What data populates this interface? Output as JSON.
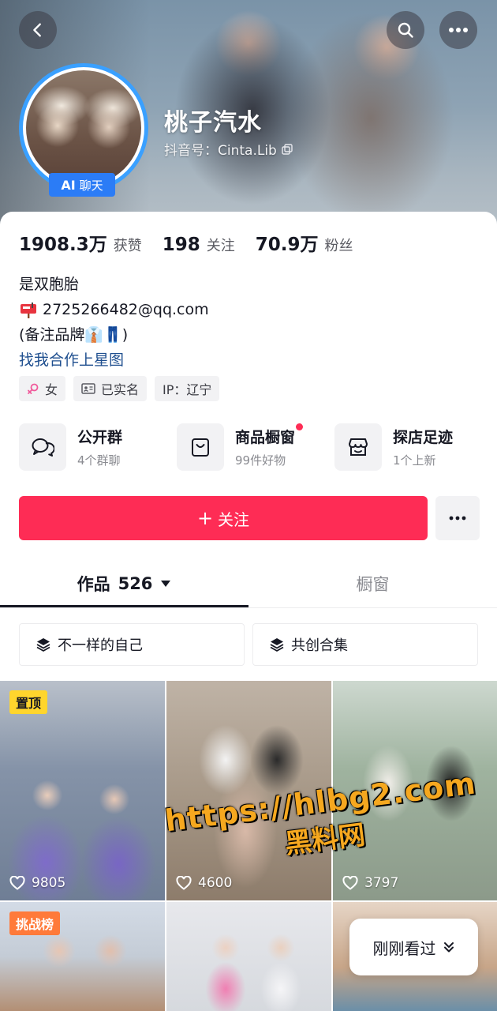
{
  "profile": {
    "nickname": "桃子汽水",
    "douyin_id": "抖音号：Cinta.Lib",
    "ai_badge": {
      "ai": "AI",
      "label": "聊天"
    }
  },
  "stats": [
    {
      "value": "1908.3万",
      "label": "获赞"
    },
    {
      "value": "198",
      "label": "关注"
    },
    {
      "value": "70.9万",
      "label": "粉丝"
    }
  ],
  "bio": {
    "line1": "是双胞胎",
    "email": "2725266482@qq.com",
    "line3": "(备注品牌👔👖)",
    "link": "找我合作上星图"
  },
  "tags": [
    {
      "icon": "female-icon",
      "label": "女"
    },
    {
      "icon": "id-card-icon",
      "label": "已实名"
    },
    {
      "icon": "",
      "label": "IP：辽宁"
    }
  ],
  "services": [
    {
      "icon": "chat-bubbles-icon",
      "title": "公开群",
      "subtitle": "4个群聊",
      "dot": false
    },
    {
      "icon": "shopping-bag-icon",
      "title": "商品橱窗",
      "subtitle": "99件好物",
      "dot": true
    },
    {
      "icon": "shop-icon",
      "title": "探店足迹",
      "subtitle": "1个上新",
      "dot": false
    }
  ],
  "actions": {
    "follow": "关注",
    "follow_plus": "+"
  },
  "tabs": {
    "works": "作品",
    "works_count": "526",
    "window": "橱窗"
  },
  "collections": [
    {
      "label": "不一样的自己"
    },
    {
      "label": "共创合集"
    }
  ],
  "videos": [
    {
      "badge": "置顶",
      "likes": "9805"
    },
    {
      "badge": "",
      "likes": "4600"
    },
    {
      "badge": "",
      "likes": "3797"
    },
    {
      "badge": "挑战榜",
      "likes": ""
    },
    {
      "badge": "",
      "likes": ""
    },
    {
      "badge": "",
      "likes": ""
    }
  ],
  "watermark": {
    "url": "https://hlbg2.com",
    "cn": "黑料网"
  },
  "just_watched": "刚刚看过",
  "colors": {
    "primary": "#fe2c55",
    "link": "#1f4f8f",
    "ai_badge": "#2b7cf6",
    "pin_badge": "#ffd52d",
    "chart_badge": "#ff7a3a"
  }
}
